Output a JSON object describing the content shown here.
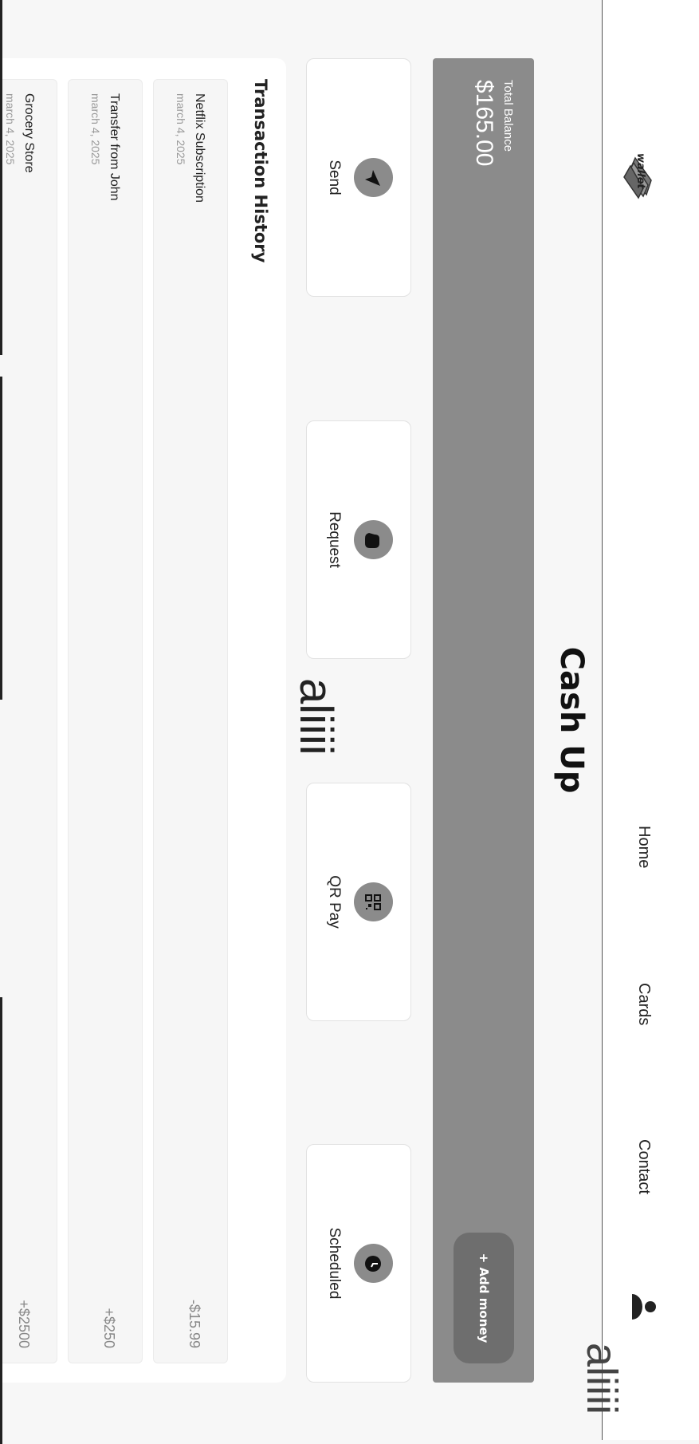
{
  "nav": {
    "logo_text": "wallet",
    "links": [
      "Home",
      "Cards",
      "Contact"
    ],
    "stamp": "aliiii"
  },
  "app": {
    "title": "Cash Up",
    "stamp": "aliiii"
  },
  "balance": {
    "label": "Total Balance",
    "amount": "$165.00",
    "add_button": "+ Add money"
  },
  "actions": [
    {
      "label": "Send",
      "icon": "send-icon"
    },
    {
      "label": "Request",
      "icon": "hand-icon"
    },
    {
      "label": "QR Pay",
      "icon": "qr-icon"
    },
    {
      "label": "Scheduled",
      "icon": "clock-icon"
    }
  ],
  "transactions": {
    "title": "Transaction History",
    "items": [
      {
        "name": "Netflix Subscription",
        "date": "march 4, 2025",
        "amount": "-$15.99"
      },
      {
        "name": "Transfer from John",
        "date": "march 4, 2025",
        "amount": "+$250"
      },
      {
        "name": "Grocery Store",
        "date": "march 4, 2025",
        "amount": "+$2500"
      }
    ]
  },
  "colors": {
    "accent": "#8b8b8b",
    "button": "#6e6e6e",
    "background": "#f7f7f7"
  }
}
